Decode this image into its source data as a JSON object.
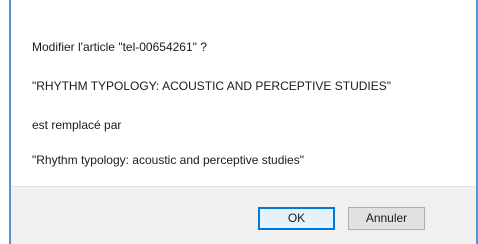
{
  "message": {
    "question": "Modifier l'article \"tel-00654261\" ?",
    "old_title": "\"RHYTHM TYPOLOGY: ACOUSTIC AND PERCEPTIVE STUDIES\"",
    "connector": "est remplacé par",
    "new_title": "\"Rhythm typology: acoustic and perceptive studies\""
  },
  "buttons": {
    "ok_label": "OK",
    "cancel_label": "Annuler"
  },
  "colors": {
    "accent": "#0078d7",
    "window_border": "#5f8fd0",
    "footer_bg": "#f0f0f0"
  }
}
